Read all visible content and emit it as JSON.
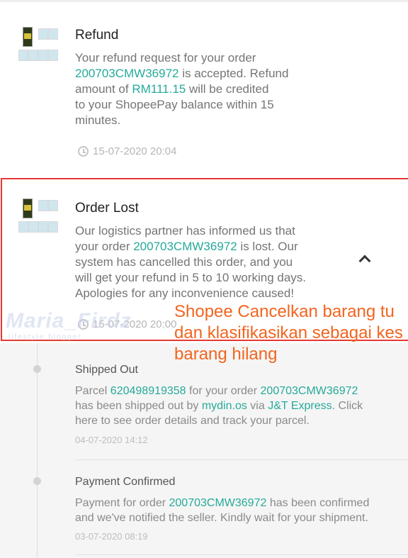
{
  "refund": {
    "title": "Refund",
    "body_part1": "Your refund request for your order",
    "order_id": "200703CMW36972",
    "body_part2": " is accepted. Refund",
    "body_part3": "amount of ",
    "amount": "RM111.15",
    "body_part4": " will be credited",
    "body_part5": "to your ShopeePay balance within 15",
    "body_part6": "minutes.",
    "time": "15-07-2020 20:04"
  },
  "order_lost": {
    "title": "Order Lost",
    "line1": "Our logistics partner has informed us that",
    "line2a": "your order ",
    "order_id": "200703CMW36972",
    "line2b": " is lost. Our",
    "line3": "system has cancelled this order, and you",
    "line4": "will get your refund in 5 to 10 working days.",
    "line5": "Apologies for any inconvenience caused!",
    "time": "15-07-2020 20:00"
  },
  "annotation": {
    "line1": "Shopee Cancelkan barang tu",
    "line2": "dan klasifikasikan sebagai kes",
    "line3": "barang hilang"
  },
  "watermark": {
    "text": "Maria_Firdz",
    "sub": "lifestyle blogger"
  },
  "timeline": [
    {
      "title": "Shipped Out",
      "l1a": "Parcel ",
      "parcel": "620498919358",
      "l1b": " for your order ",
      "order_id": "200703CMW36972",
      "l2a": "has been shipped out by ",
      "seller": "mydin.os",
      "l2b": " via ",
      "courier": "J&T Express",
      "l2c": ". Click",
      "l3": "here to see order details and track your parcel.",
      "time": "04-07-2020 14:12"
    },
    {
      "title": "Payment Confirmed",
      "l1a": "Payment for order ",
      "order_id": "200703CMW36972",
      "l1b": " has been confirmed",
      "l2": "and we've notified the seller. Kindly wait for your shipment.",
      "time": "03-07-2020 08:19"
    }
  ],
  "colors": {
    "link": "#26aa99",
    "annotation": "#f2651f",
    "highlight_border": "#e53935"
  },
  "icons": [
    "clock-icon",
    "chevron-up-icon",
    "product-thumbnail"
  ]
}
